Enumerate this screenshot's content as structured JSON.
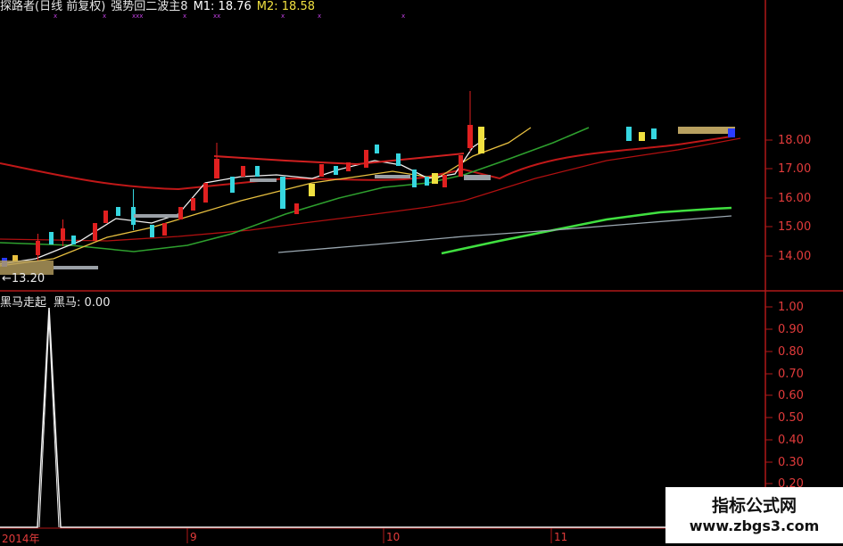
{
  "top_panel": {
    "title": "探路者(日线 前复权)",
    "indicator": "强势回二波主8",
    "m1_label": "M1: 18.76",
    "m2_label": "M2: 18.58",
    "price_ticks": [
      "18.00",
      "17.00",
      "16.00",
      "15.00",
      "14.00"
    ],
    "low_marker": "←13.20",
    "colors": {
      "up": "#e02020",
      "down": "#36d6e0",
      "ma_fast": "#ffffff",
      "ma_yellow": "#e8c040",
      "ma_green": "#2ea02e",
      "ma_red": "#c01818",
      "ma_lime": "#40e040",
      "ma_gray": "#9aa7b0"
    }
  },
  "bottom_panel": {
    "title": "黑马走起",
    "value_label": "黑马: 0.00",
    "ticks": [
      "1.00",
      "0.90",
      "0.80",
      "0.70",
      "0.60",
      "0.50",
      "0.40",
      "0.30",
      "0.20"
    ]
  },
  "date_axis": [
    "2014年",
    "9",
    "10",
    "11"
  ],
  "watermark": {
    "line1": "指标公式网",
    "line2": "www.zbgs3.com"
  }
}
